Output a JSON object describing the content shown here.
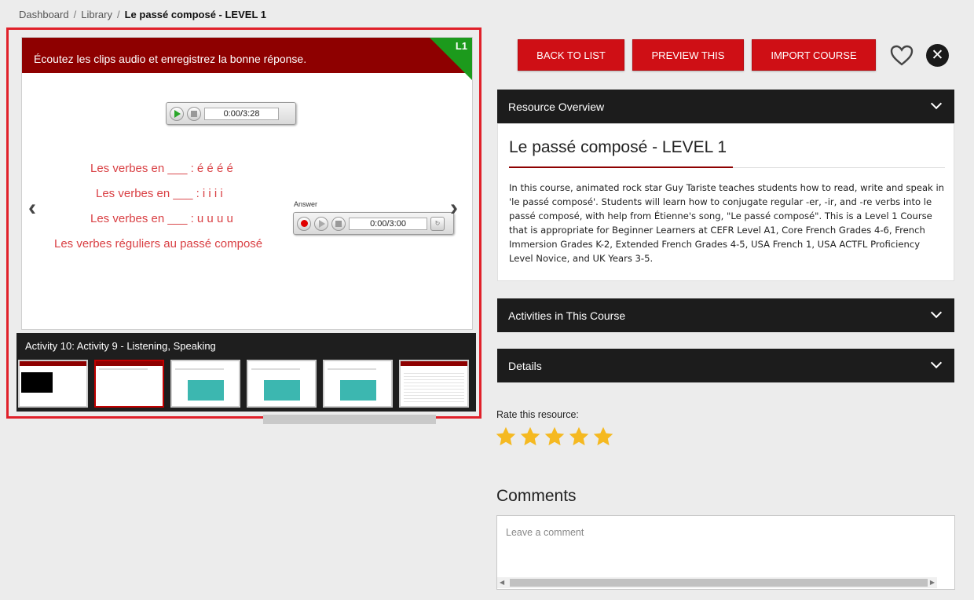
{
  "breadcrumb": {
    "items": [
      "Dashboard",
      "Library"
    ],
    "separator": "/",
    "current": "Le passé composé - LEVEL 1"
  },
  "preview": {
    "slide_instruction": "Écoutez les clips audio et enregistrez la bonne réponse.",
    "level_badge": "L1",
    "audio_player_time": "0:00/3:28",
    "answer_label": "Answer",
    "answer_player_time": "0:00/3:00",
    "verb_lines": [
      "Les verbes en ___ :  é é é é",
      "Les verbes en ___ :  i i i i",
      "Les verbes en ___ :  u u u u",
      "Les verbes réguliers au passé composé"
    ],
    "activity_title": "Activity 10: Activity 9 - Listening, Speaking",
    "active_thumb_index": 1
  },
  "toolbar": {
    "back_label": "BACK TO LIST",
    "preview_label": "PREVIEW THIS",
    "import_label": "IMPORT COURSE"
  },
  "panels": {
    "overview_header": "Resource Overview",
    "activities_header": "Activities in This Course",
    "details_header": "Details"
  },
  "overview": {
    "title": "Le passé composé - LEVEL 1",
    "description": "In this course, animated rock star Guy Tariste teaches students how to read, write and speak in 'le passé composé'. Students will learn how to conjugate regular -er, -ir, and -re verbs into le passé composé, with help from Étienne's song, \"Le passé composé\". This is a Level 1 Course that is appropriate for Beginner Learners at CEFR Level A1, Core French Grades 4-6, French Immersion Grades K-2, Extended French Grades 4-5, USA French 1, USA ACTFL Proficiency Level Novice, and UK Years 3-5."
  },
  "rating": {
    "label": "Rate this resource:",
    "stars": 5,
    "star_color": "#f5b921"
  },
  "comments": {
    "title": "Comments",
    "placeholder": "Leave a comment"
  },
  "colors": {
    "accent_red": "#cf0f15",
    "header_dark": "#1c1c1c",
    "slide_header": "#8e0000",
    "level_green": "#1c9a1c"
  }
}
